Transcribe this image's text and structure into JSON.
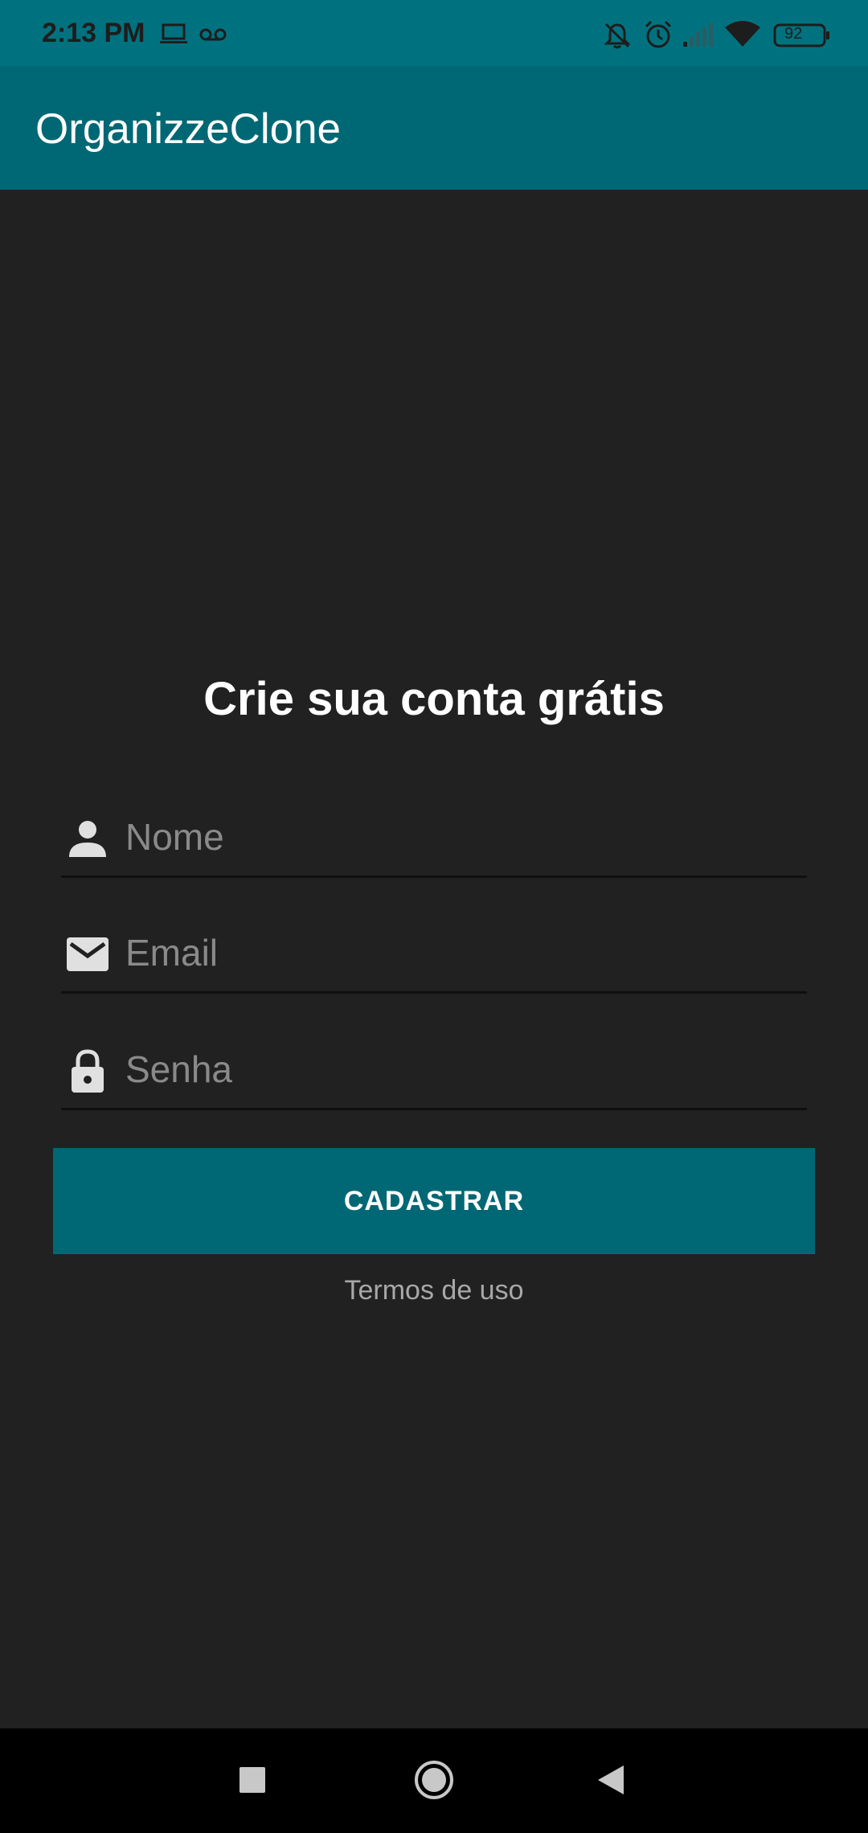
{
  "status_bar": {
    "time": "2:13 PM",
    "battery": "92",
    "icons": [
      "laptop-icon",
      "voicemail-icon",
      "bell-off-icon",
      "alarm-icon",
      "signal-icon",
      "wifi-icon",
      "battery-icon"
    ]
  },
  "app_bar": {
    "title": "OrganizzeClone"
  },
  "main": {
    "heading": "Crie sua conta grátis",
    "fields": {
      "name_placeholder": "Nome",
      "email_placeholder": "Email",
      "password_placeholder": "Senha"
    },
    "submit_label": "CADASTRAR",
    "terms_label": "Termos de uso"
  },
  "nav_bar": {
    "icons": [
      "recents-icon",
      "home-icon",
      "back-icon"
    ]
  },
  "colors": {
    "primary": "#006874",
    "status_bar": "#00727f",
    "background": "#212121"
  }
}
